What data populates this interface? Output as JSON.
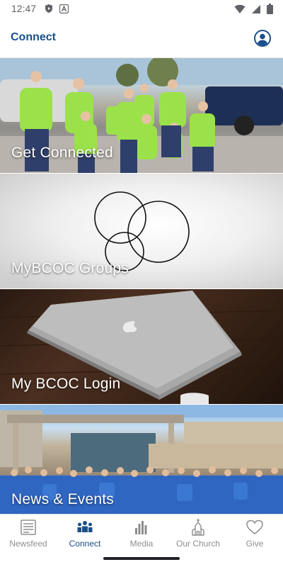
{
  "status_bar": {
    "time": "12:47"
  },
  "app_bar": {
    "title": "Connect",
    "profile_icon": "account-circle-icon"
  },
  "tiles": [
    {
      "label": "Get Connected",
      "image": "group-photo-green-shirts"
    },
    {
      "label": "MyBCOC Groups",
      "image": "overlapping-circles"
    },
    {
      "label": "My BCOC Login",
      "image": "laptop-on-table"
    },
    {
      "label": "News & Events",
      "image": "crowd-blue-shirts-building"
    }
  ],
  "bottom_nav": {
    "items": [
      {
        "label": "Newsfeed",
        "icon": "newspaper-icon"
      },
      {
        "label": "Connect",
        "icon": "people-icon",
        "active": true
      },
      {
        "label": "Media",
        "icon": "equalizer-icon"
      },
      {
        "label": "Our Church",
        "icon": "church-icon"
      },
      {
        "label": "Give",
        "icon": "heart-icon"
      }
    ]
  },
  "colors": {
    "brand": "#1a4f8b",
    "inactive": "#8e8e8e"
  }
}
